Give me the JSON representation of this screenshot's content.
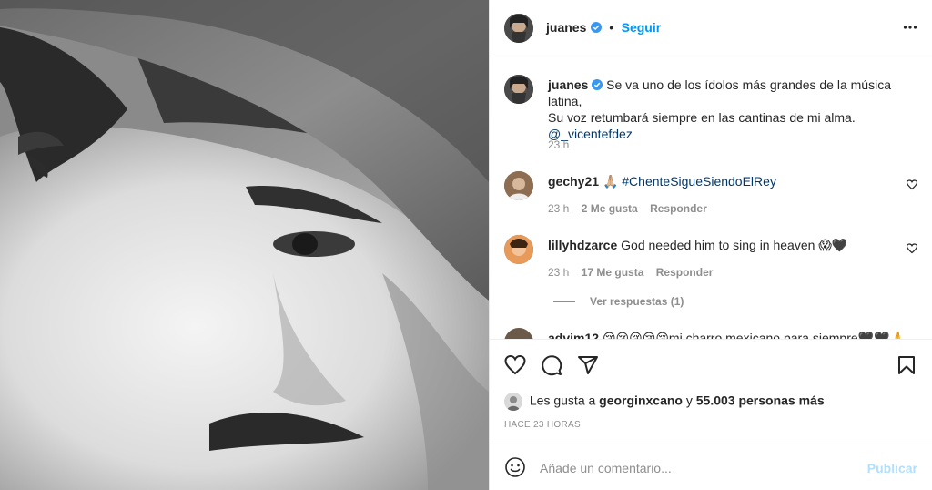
{
  "post": {
    "username": "juanes",
    "follow_label": "Seguir",
    "dot": "•",
    "more_icon": "more-horizontal-icon",
    "caption": {
      "username": "juanes",
      "text_line1": "Se va uno de los ídolos más grandes de la música latina,",
      "text_line2": "Su voz retumbará siempre en las cantinas de mi alma.",
      "mention": "@_vicentefdez",
      "time": "23 h"
    },
    "comments": [
      {
        "username": "gechy21",
        "emoji": "🙏🏼",
        "text": "#ChenteSigueSiendoElRey",
        "time": "23 h",
        "likes": "2 Me gusta",
        "reply": "Responder"
      },
      {
        "username": "lillyhdzarce",
        "text": "God needed him to sing in heaven",
        "emoji": "😱🖤",
        "time": "23 h",
        "likes": "17 Me gusta",
        "reply": "Responder",
        "view_replies": "Ver respuestas (1)"
      },
      {
        "username": "advim12",
        "text": "😢😢😢😢😢mi charro mexicano para siempre🖤🖤🙏"
      }
    ],
    "likes_prefix": "Les gusta a",
    "likes_user": "georginxcano",
    "likes_mid": "y",
    "likes_count": "55.003 personas más",
    "timestamp": "HACE 23 HORAS",
    "comment_placeholder": "Añade un comentario...",
    "publish_label": "Publicar"
  },
  "colors": {
    "accent": "#0095f6",
    "publish_disabled": "#b2dffc",
    "muted": "#8e8e8e",
    "text": "#262626",
    "verified": "#3897f0"
  }
}
